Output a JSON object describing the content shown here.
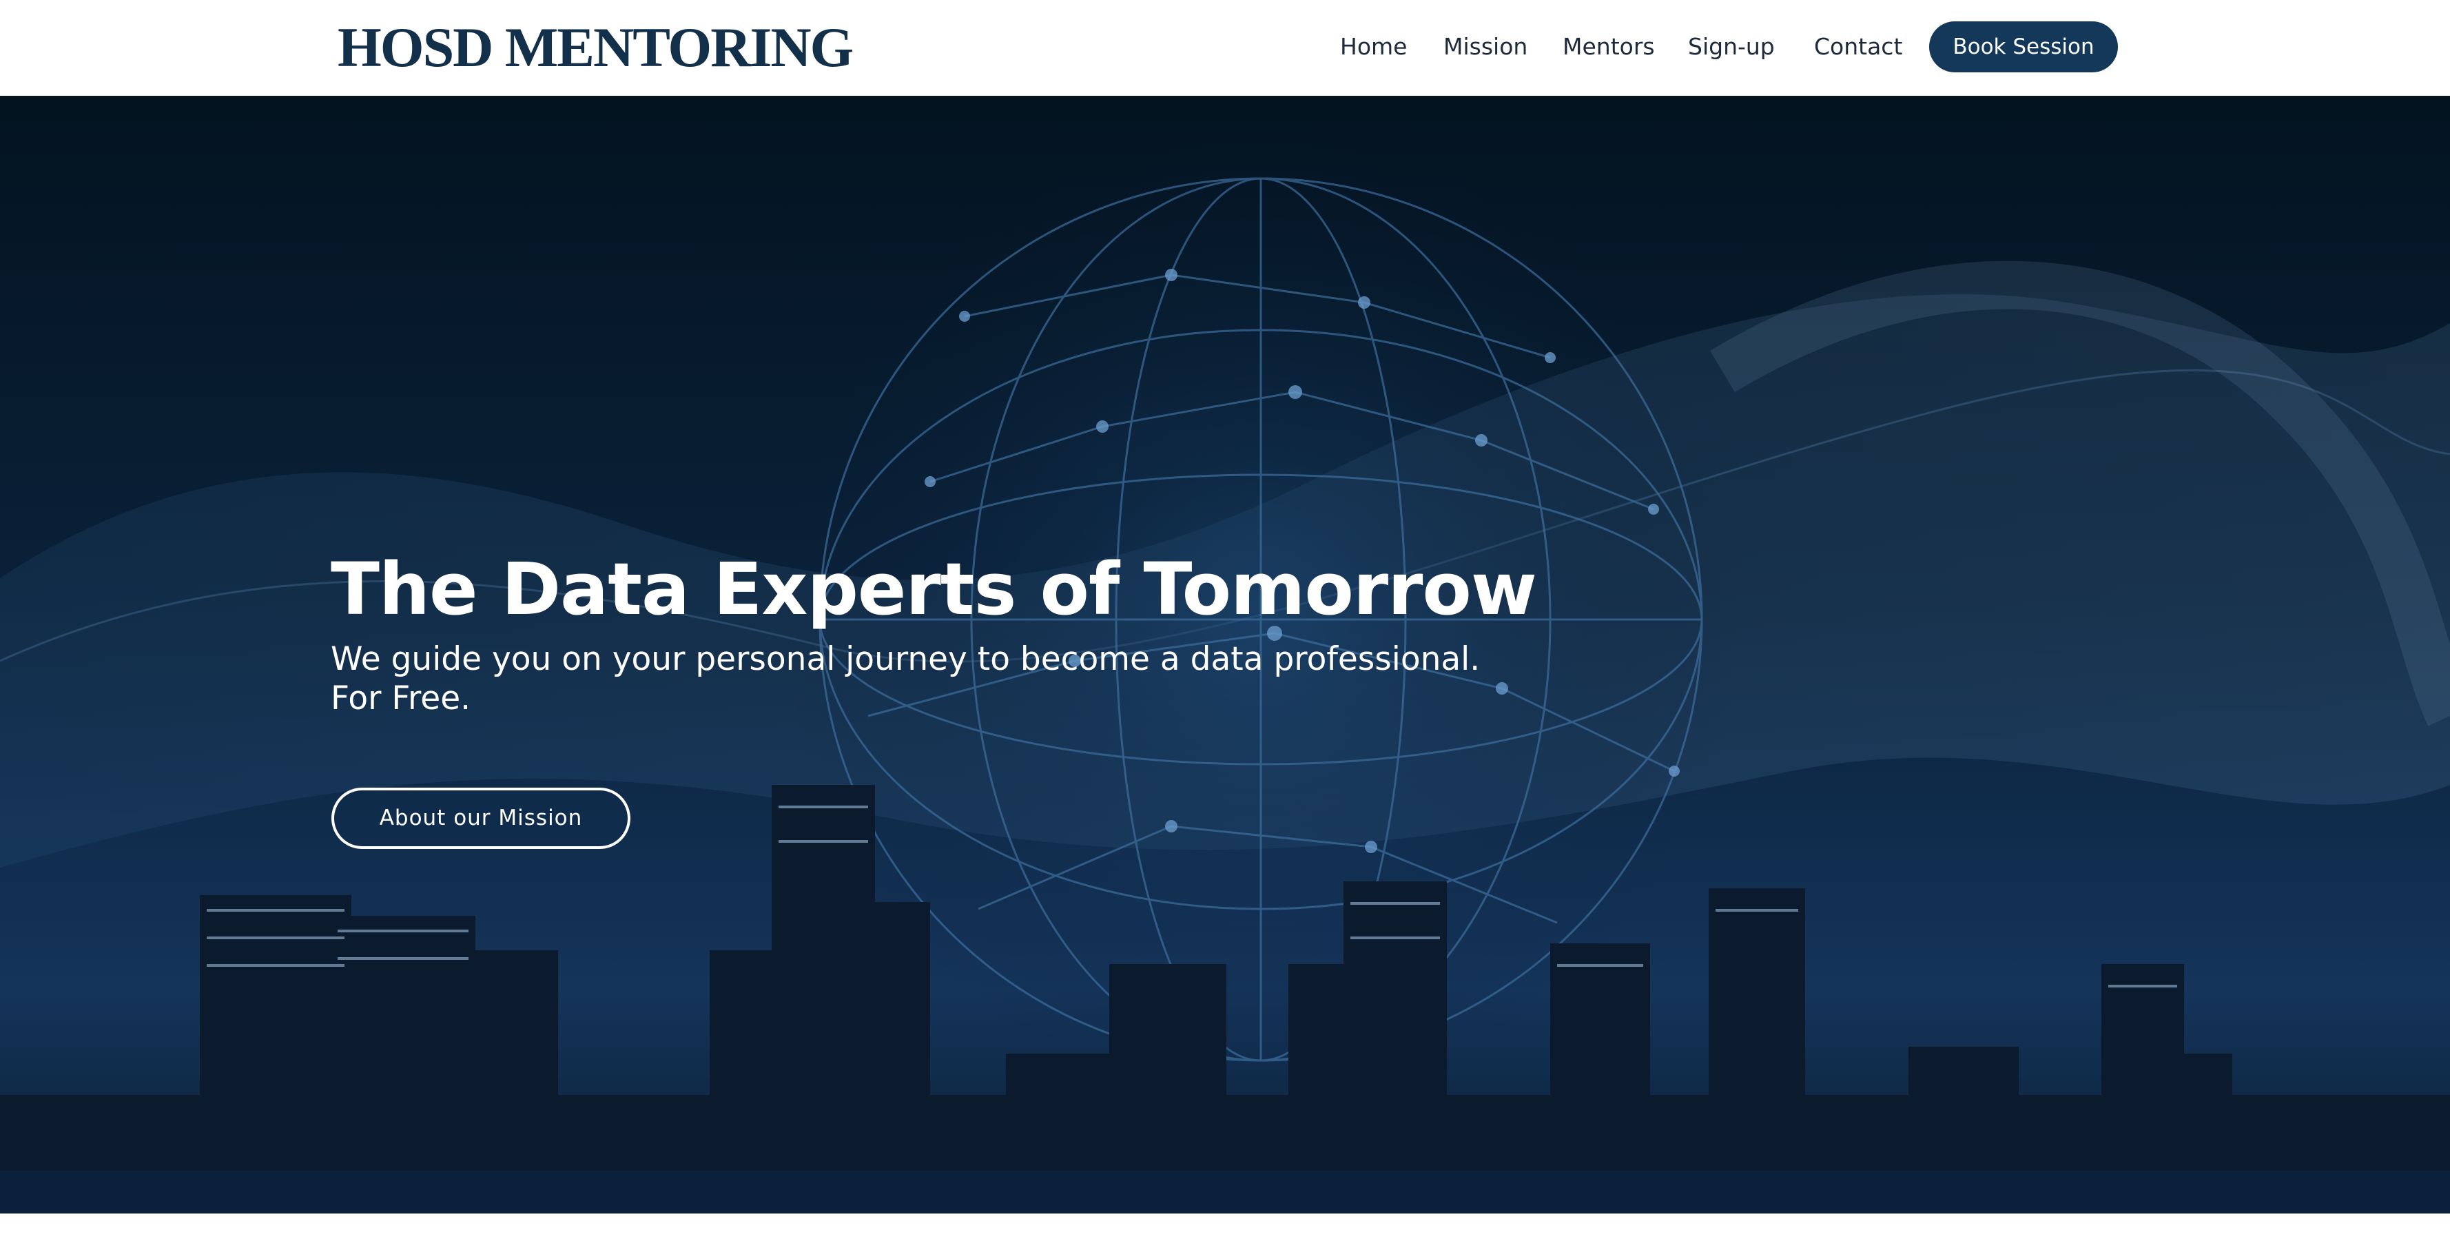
{
  "header": {
    "logo": "HOSD MENTORING",
    "nav": [
      "Home",
      "Mission",
      "Mentors",
      "Sign-up",
      "Contact"
    ],
    "cta_label": "Book Session"
  },
  "hero": {
    "title": "The Data Experts of Tomorrow",
    "subtitle_line1": "We guide you on your personal journey to become a data professional.",
    "subtitle_line2": "For Free.",
    "button_label": "About our Mission"
  },
  "colors": {
    "brand_navy": "#13304a",
    "button_navy": "#13385a",
    "hero_bg": "#061626",
    "text_light": "#ffffff"
  },
  "icons": [
    "network-globe-graphic",
    "city-skyline-image"
  ]
}
